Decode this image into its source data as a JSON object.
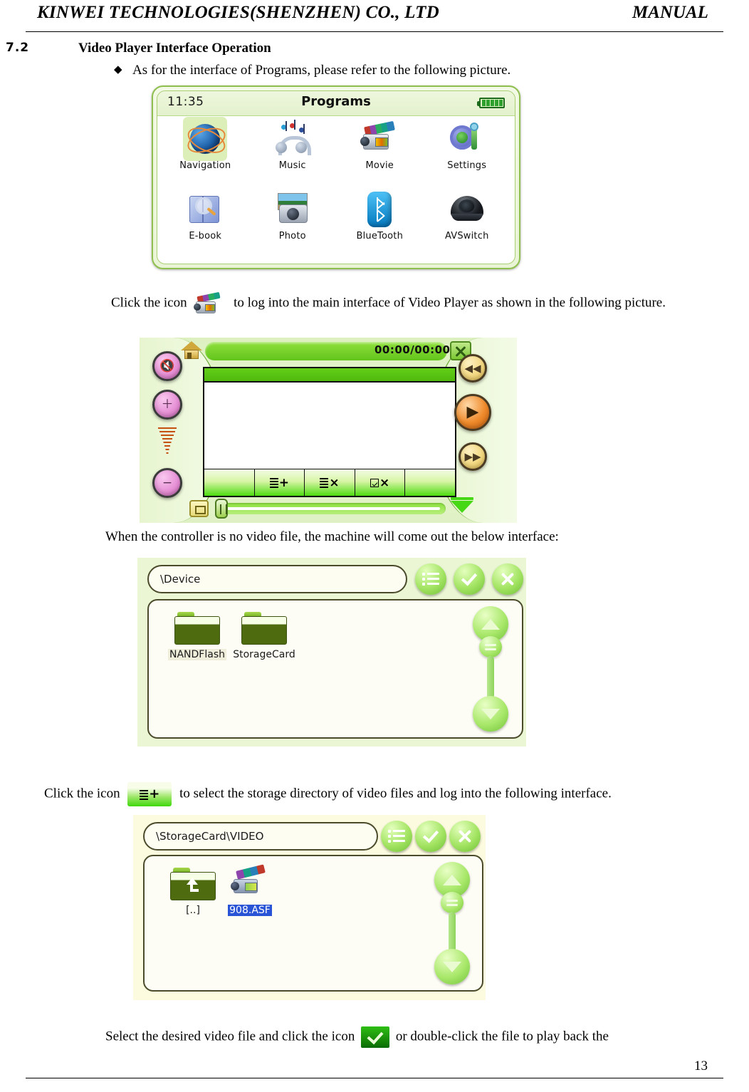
{
  "header": {
    "company": "KINWEI TECHNOLOGIES(SHENZHEN) CO., LTD",
    "doc_type": "MANUAL"
  },
  "section": {
    "number": "7.2",
    "title": "Video Player Interface Operation"
  },
  "bullets": [
    {
      "glyph": "◆",
      "text": "As for the interface of Programs, please refer to the following picture."
    }
  ],
  "paragraphs": {
    "click_movie_icon_before": "Click the icon",
    "click_movie_icon_after": "to log into the main interface of Video Player as shown in the following picture.",
    "no_video_file": "When the controller is no video file, the machine will come out the below interface:",
    "click_listplus_before": "Click the icon",
    "click_listplus_after": "to select the storage directory of video files and log into the following interface.",
    "select_file_before": "Select the desired video file and click the icon",
    "select_file_after": "or double-click the file to play back the"
  },
  "programs_screen": {
    "time": "11:35",
    "title": "Programs",
    "battery_level": "full",
    "items": [
      {
        "label": "Navigation",
        "icon": "globe-icon",
        "selected": true
      },
      {
        "label": "Music",
        "icon": "music-note-headphones-icon",
        "selected": false
      },
      {
        "label": "Movie",
        "icon": "camcorder-film-icon",
        "selected": false
      },
      {
        "label": "Settings",
        "icon": "gear-wrench-icon",
        "selected": false
      },
      {
        "label": "E-book",
        "icon": "book-magnifier-icon",
        "selected": false
      },
      {
        "label": "Photo",
        "icon": "camera-icon",
        "selected": false
      },
      {
        "label": "BlueTooth",
        "icon": "bluetooth-icon",
        "selected": false
      },
      {
        "label": "AVSwitch",
        "icon": "dome-camera-icon",
        "selected": false
      }
    ]
  },
  "player_screen": {
    "time_display": "00:00/00:00",
    "home_icon": "home-icon",
    "close_icon": "close-x-icon",
    "left_buttons": [
      {
        "name": "mute-button",
        "glyph": "🔇"
      },
      {
        "name": "volume-up-button",
        "glyph": "＋"
      },
      {
        "name": "volume-down-button",
        "glyph": "−"
      }
    ],
    "right_buttons": [
      {
        "name": "rewind-button",
        "glyph": "◀◀"
      },
      {
        "name": "play-button",
        "glyph": "▶"
      },
      {
        "name": "forward-button",
        "glyph": "▶▶"
      }
    ],
    "toolbar_cells": [
      {
        "name": "blank-cell",
        "label": ""
      },
      {
        "name": "add-to-list-button",
        "label": "+"
      },
      {
        "name": "remove-from-list-button",
        "label": "×"
      },
      {
        "name": "clear-selected-button",
        "label": "×"
      },
      {
        "name": "blank-cell",
        "label": ""
      }
    ],
    "fullscreen_icon": "fullscreen-icon",
    "progress_value": 0,
    "collapse_icon": "collapse-down-icon"
  },
  "browser_device": {
    "path": "\\Device",
    "toolbar": [
      {
        "name": "list-view-button",
        "icon": "list-icon"
      },
      {
        "name": "confirm-button",
        "icon": "check-icon"
      },
      {
        "name": "cancel-button",
        "icon": "close-x-icon"
      }
    ],
    "items": [
      {
        "label": "NANDFlash",
        "type": "folder",
        "highlighted": true
      },
      {
        "label": "StorageCard",
        "type": "folder",
        "highlighted": false
      }
    ],
    "scrollbar": {
      "up_icon": "scroll-up-icon",
      "thumb_icon": "scroll-thumb-icon",
      "down_icon": "scroll-down-icon"
    }
  },
  "browser_video": {
    "path": "\\StorageCard\\VIDEO",
    "toolbar": [
      {
        "name": "list-view-button",
        "icon": "list-icon"
      },
      {
        "name": "confirm-button",
        "icon": "check-icon"
      },
      {
        "name": "cancel-button",
        "icon": "close-x-icon"
      }
    ],
    "items": [
      {
        "label": "[..]",
        "type": "parent-folder",
        "selected": false
      },
      {
        "label": "908.ASF",
        "type": "video-file",
        "selected": true
      }
    ],
    "scrollbar": {
      "up_icon": "scroll-up-icon",
      "thumb_icon": "scroll-thumb-icon",
      "down_icon": "scroll-down-icon"
    }
  },
  "footer": {
    "page_number": "13"
  },
  "colors": {
    "device_green": "#8fbf4e",
    "bar_green": "#62c41a",
    "browser_bg_green": "#eaf6d4",
    "browser_bg_yellow": "#fcfbdf",
    "selected_blue": "#2a54d6",
    "play_orange": "#ef8b2c",
    "volume_pink": "#e48ad2"
  }
}
